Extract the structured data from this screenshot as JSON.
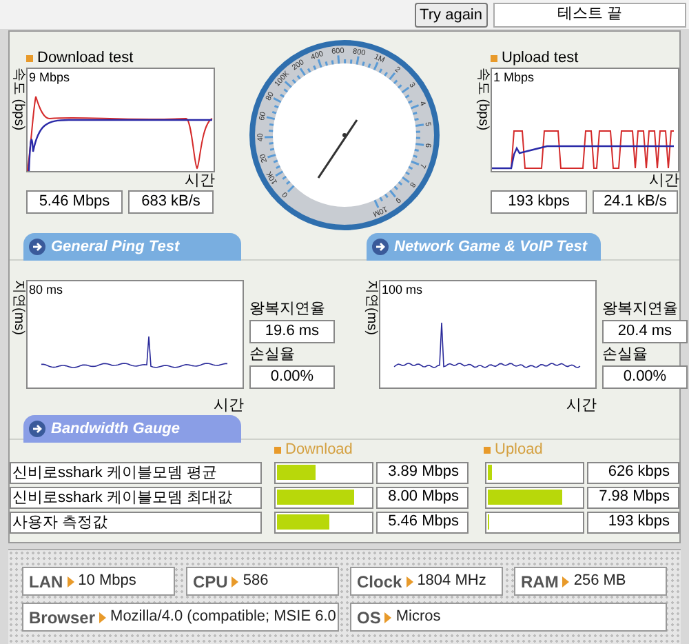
{
  "header": {
    "try_again": "Try again",
    "status": "테스트 끝"
  },
  "speed_tests": [
    {
      "title": "Download test",
      "scale": "9 Mbps",
      "axis_label": "속도 (bps)",
      "time_label": "시간",
      "readings": [
        "5.46 Mbps",
        "683 kB/s"
      ]
    },
    {
      "title": "Upload test",
      "scale": "1 Mbps",
      "axis_label": "속도 (bps)",
      "time_label": "시간",
      "readings": [
        "193 kbps",
        "24.1 kB/s"
      ]
    }
  ],
  "gauge": {
    "labels": [
      "0",
      "10K",
      "20",
      "40",
      "60",
      "80",
      "100K",
      "200",
      "400",
      "600",
      "800",
      "1M",
      "2",
      "3",
      "4",
      "5",
      "6",
      "7",
      "8",
      "9",
      "10M"
    ]
  },
  "ping_tabs": [
    "General Ping Test",
    "Network Game & VoIP Test"
  ],
  "ping_tests": [
    {
      "scale": "80 ms",
      "axis_label": "지연(ms)",
      "time_label": "시간",
      "latency_label": "왕복지연율",
      "latency": "19.6 ms",
      "loss_label": "손실율",
      "loss": "0.00%"
    },
    {
      "scale": "100 ms",
      "axis_label": "지연(ms)",
      "time_label": "시간",
      "latency_label": "왕복지연율",
      "latency": "20.4 ms",
      "loss_label": "손실율",
      "loss": "0.00%"
    }
  ],
  "bandwidth_tab": "Bandwidth Gauge",
  "bandwidth": {
    "columns": [
      "Download",
      "Upload"
    ],
    "rows": [
      {
        "label": "신비로sshark 케이블모뎀 평균",
        "download": {
          "level": 0.41,
          "value": "3.89 Mbps"
        },
        "upload": {
          "level": 0.04,
          "value": "626 kbps"
        }
      },
      {
        "label": "신비로sshark 케이블모뎀 최대값",
        "download": {
          "level": 0.82,
          "value": "8.00 Mbps"
        },
        "upload": {
          "level": 0.8,
          "value": "7.98 Mbps"
        }
      },
      {
        "label": "사용자 측정값",
        "download": {
          "level": 0.56,
          "value": "5.46 Mbps"
        },
        "upload": {
          "level": 0.02,
          "value": "193 kbps"
        }
      }
    ]
  },
  "system_info": [
    {
      "label": "LAN",
      "value": "10 Mbps"
    },
    {
      "label": "CPU",
      "value": "586"
    },
    {
      "label": "Clock",
      "value": "1804 MHz"
    },
    {
      "label": "RAM",
      "value": "256 MB"
    },
    {
      "label": "Browser",
      "value": "Mozilla/4.0 (compatible; MSIE 6.0"
    },
    {
      "label": "OS",
      "value": "Micros"
    }
  ]
}
